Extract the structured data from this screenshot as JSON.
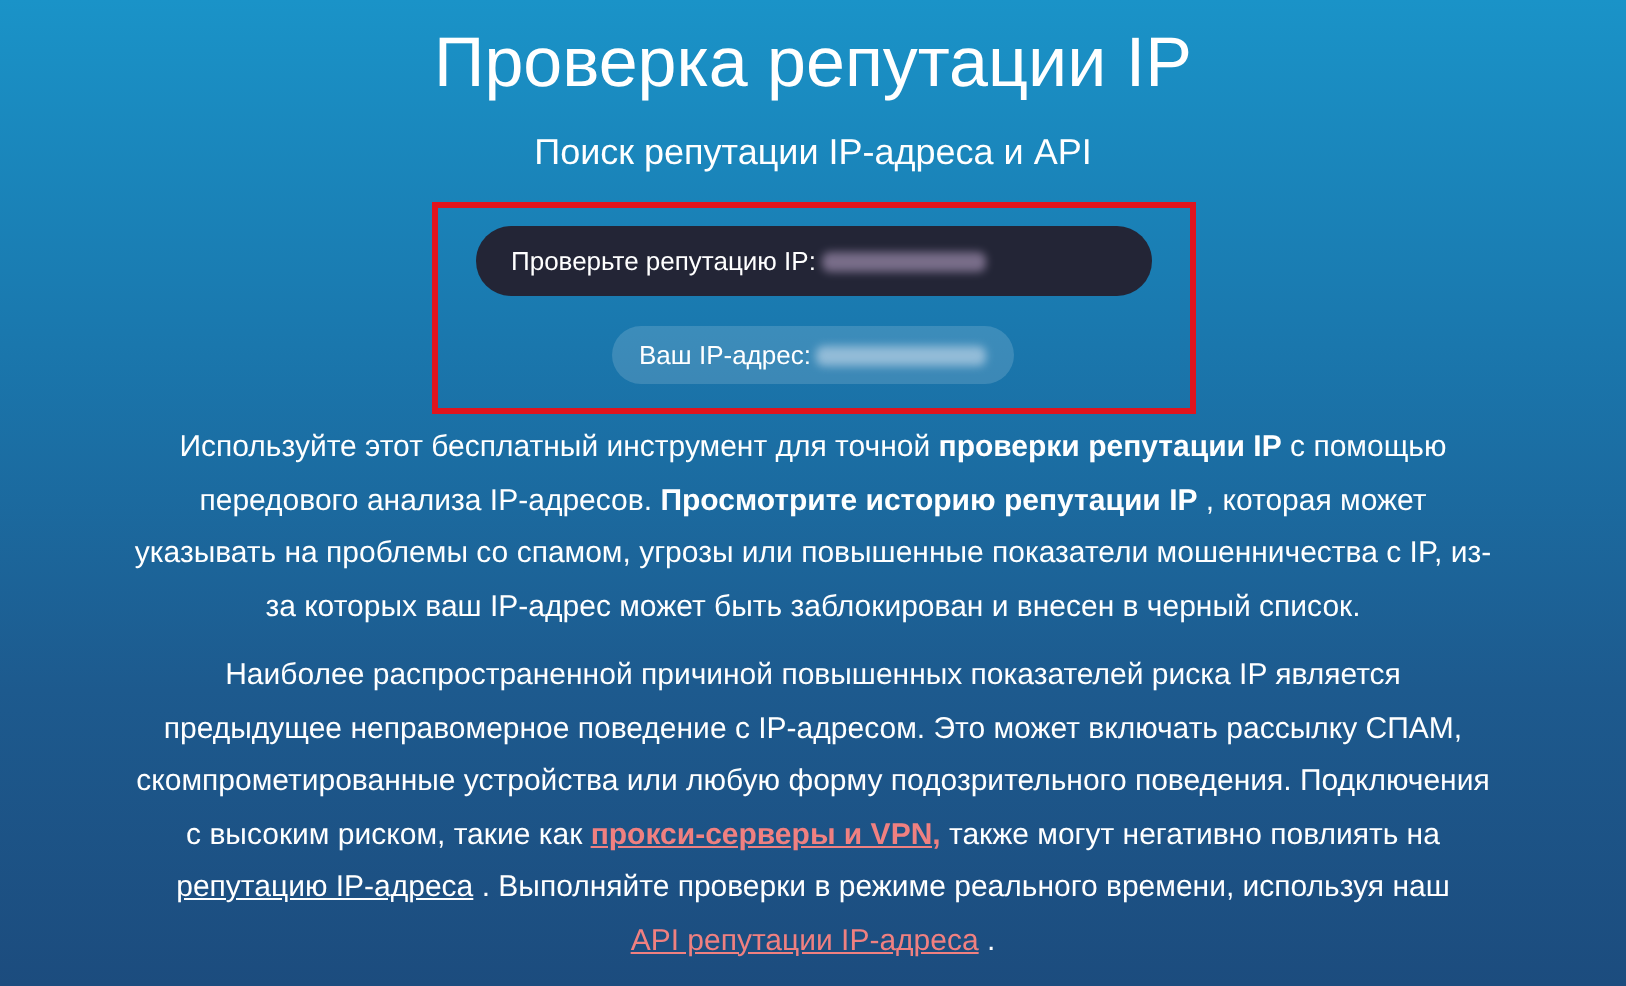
{
  "title": "Проверка репутации IP",
  "subtitle": "Поиск репутации IP-адреса и API",
  "check_bar": {
    "label": "Проверьте репутацию IP:"
  },
  "your_ip": {
    "label": "Ваш IP-адрес:"
  },
  "paragraphs": [
    [
      {
        "kind": "text",
        "text": "Используйте этот бесплатный инструмент для точной **проверки репутации IP** с помощью передового анализа IP-адресов. **Просмотрите историю репутации IP** , которая может указывать на проблемы со спамом, угрозы или повышенные показатели мошенничества с IP, из-за которых ваш IP-адрес может быть заблокирован и внесен в черный список."
      }
    ],
    [
      {
        "kind": "text",
        "text": "Наиболее распространенной причиной повышенных показателей риска IP является предыдущее неправомерное поведение с IP-адресом. Это может включать рассылку СПАМ, скомпрометированные устройства или любую форму подозрительного поведения. Подключения с высоким риском, такие как "
      },
      {
        "kind": "link_bold",
        "text": "прокси-серверы и VPN,"
      },
      {
        "kind": "text",
        "text": " также могут негативно повлиять на "
      },
      {
        "kind": "link_plain",
        "text": "репутацию IP-адреса"
      },
      {
        "kind": "text",
        "text": " . Выполняйте проверки в режиме реального времени, используя наш "
      },
      {
        "kind": "link",
        "text": "API репутации IP-адреса"
      },
      {
        "kind": "text",
        "text": " ."
      }
    ]
  ]
}
